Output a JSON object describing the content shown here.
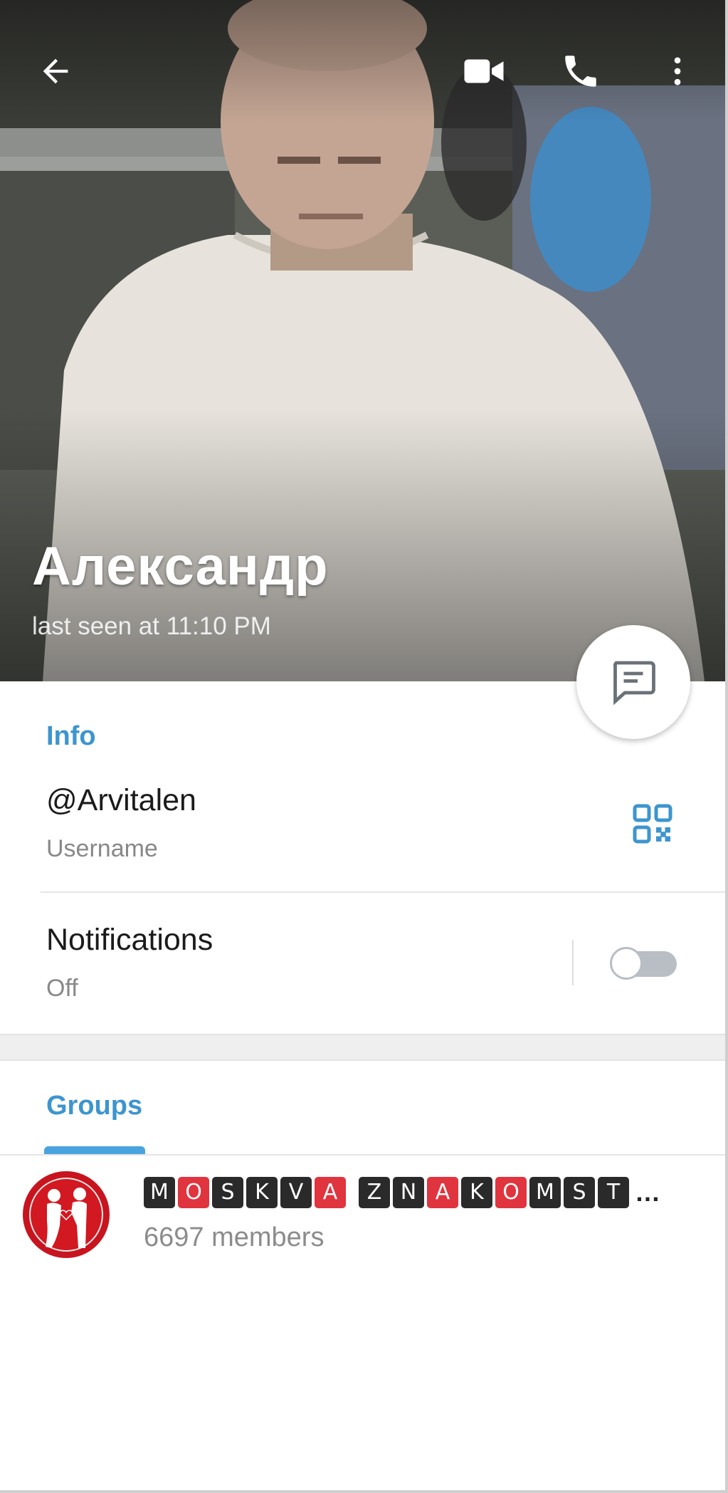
{
  "header": {
    "name": "Александр",
    "status": "last seen at 11:10 PM",
    "icons": [
      "back-arrow-icon",
      "video-call-icon",
      "phone-icon",
      "more-vertical-icon"
    ]
  },
  "fab": {
    "icon": "message-icon"
  },
  "info": {
    "section_title": "Info",
    "username": "@Arvitalen",
    "username_caption": "Username",
    "qr_icon": "qr-code-icon",
    "notifications_label": "Notifications",
    "notifications_value": "Off",
    "notifications_enabled": false
  },
  "groups": {
    "section_title": "Groups",
    "items": [
      {
        "name": "MOSKVA ZNAKOMST…",
        "name_letters": [
          "M",
          "O",
          "S",
          "K",
          "V",
          "A",
          " ",
          "Z",
          "N",
          "A",
          "K",
          "O",
          "M",
          "S",
          "T"
        ],
        "name_letter_colors": [
          "dark",
          "red",
          "dark",
          "dark",
          "dark",
          "red",
          "",
          "dark",
          "dark",
          "red",
          "dark",
          "red",
          "dark",
          "dark",
          "dark"
        ],
        "members": "6697 members"
      }
    ]
  },
  "colors": {
    "accent": "#3d95ce",
    "tab_indicator": "#4aa3df",
    "tile_dark": "#2a2a2a",
    "tile_red": "#e0343e",
    "avatar_red": "#c8141e"
  }
}
